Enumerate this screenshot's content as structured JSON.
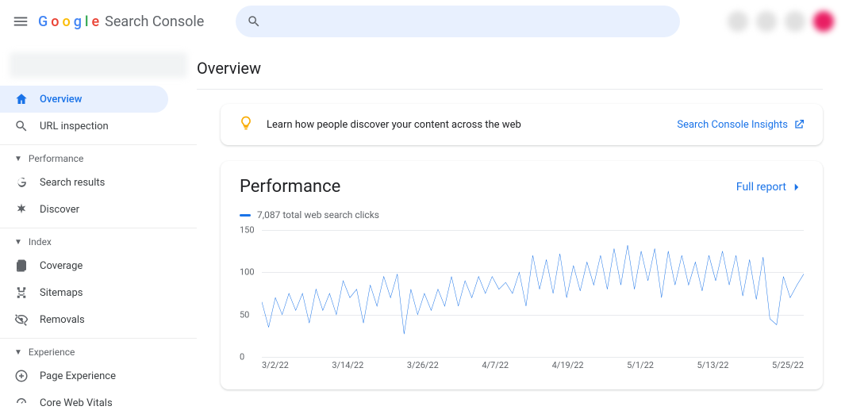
{
  "header": {
    "brand_word": "Google",
    "brand_suffix": "Search Console"
  },
  "sidebar": {
    "items": [
      {
        "label": "Overview"
      },
      {
        "label": "URL inspection"
      }
    ],
    "groups": [
      {
        "label": "Performance",
        "items": [
          {
            "label": "Search results"
          },
          {
            "label": "Discover"
          }
        ]
      },
      {
        "label": "Index",
        "items": [
          {
            "label": "Coverage"
          },
          {
            "label": "Sitemaps"
          },
          {
            "label": "Removals"
          }
        ]
      },
      {
        "label": "Experience",
        "items": [
          {
            "label": "Page Experience"
          },
          {
            "label": "Core Web Vitals"
          }
        ]
      }
    ]
  },
  "page": {
    "title": "Overview"
  },
  "insights": {
    "text": "Learn how people discover your content across the web",
    "link": "Search Console Insights"
  },
  "performance": {
    "title": "Performance",
    "link": "Full report",
    "legend": "7,087 total web search clicks"
  },
  "chart_data": {
    "type": "line",
    "title": "Performance",
    "ylabel": "",
    "xlabel": "",
    "ylim": [
      0,
      150
    ],
    "yticks": [
      0,
      50,
      100,
      150
    ],
    "x_tick_labels": [
      "3/2/22",
      "3/14/22",
      "3/26/22",
      "4/7/22",
      "4/19/22",
      "5/1/22",
      "5/13/22",
      "5/25/22"
    ],
    "series": [
      {
        "name": "total web search clicks",
        "color": "#1a73e8",
        "values": [
          65,
          35,
          70,
          50,
          75,
          55,
          75,
          40,
          80,
          55,
          75,
          50,
          90,
          70,
          80,
          40,
          85,
          60,
          95,
          70,
          98,
          27,
          80,
          50,
          75,
          55,
          80,
          60,
          95,
          60,
          90,
          70,
          95,
          75,
          95,
          80,
          88,
          75,
          100,
          60,
          120,
          80,
          115,
          75,
          122,
          70,
          108,
          78,
          112,
          85,
          120,
          80,
          128,
          85,
          132,
          80,
          125,
          90,
          128,
          70,
          125,
          85,
          120,
          85,
          112,
          78,
          120,
          90,
          125,
          85,
          120,
          72,
          115,
          68,
          118,
          45,
          38,
          95,
          70,
          85,
          98
        ]
      }
    ]
  }
}
